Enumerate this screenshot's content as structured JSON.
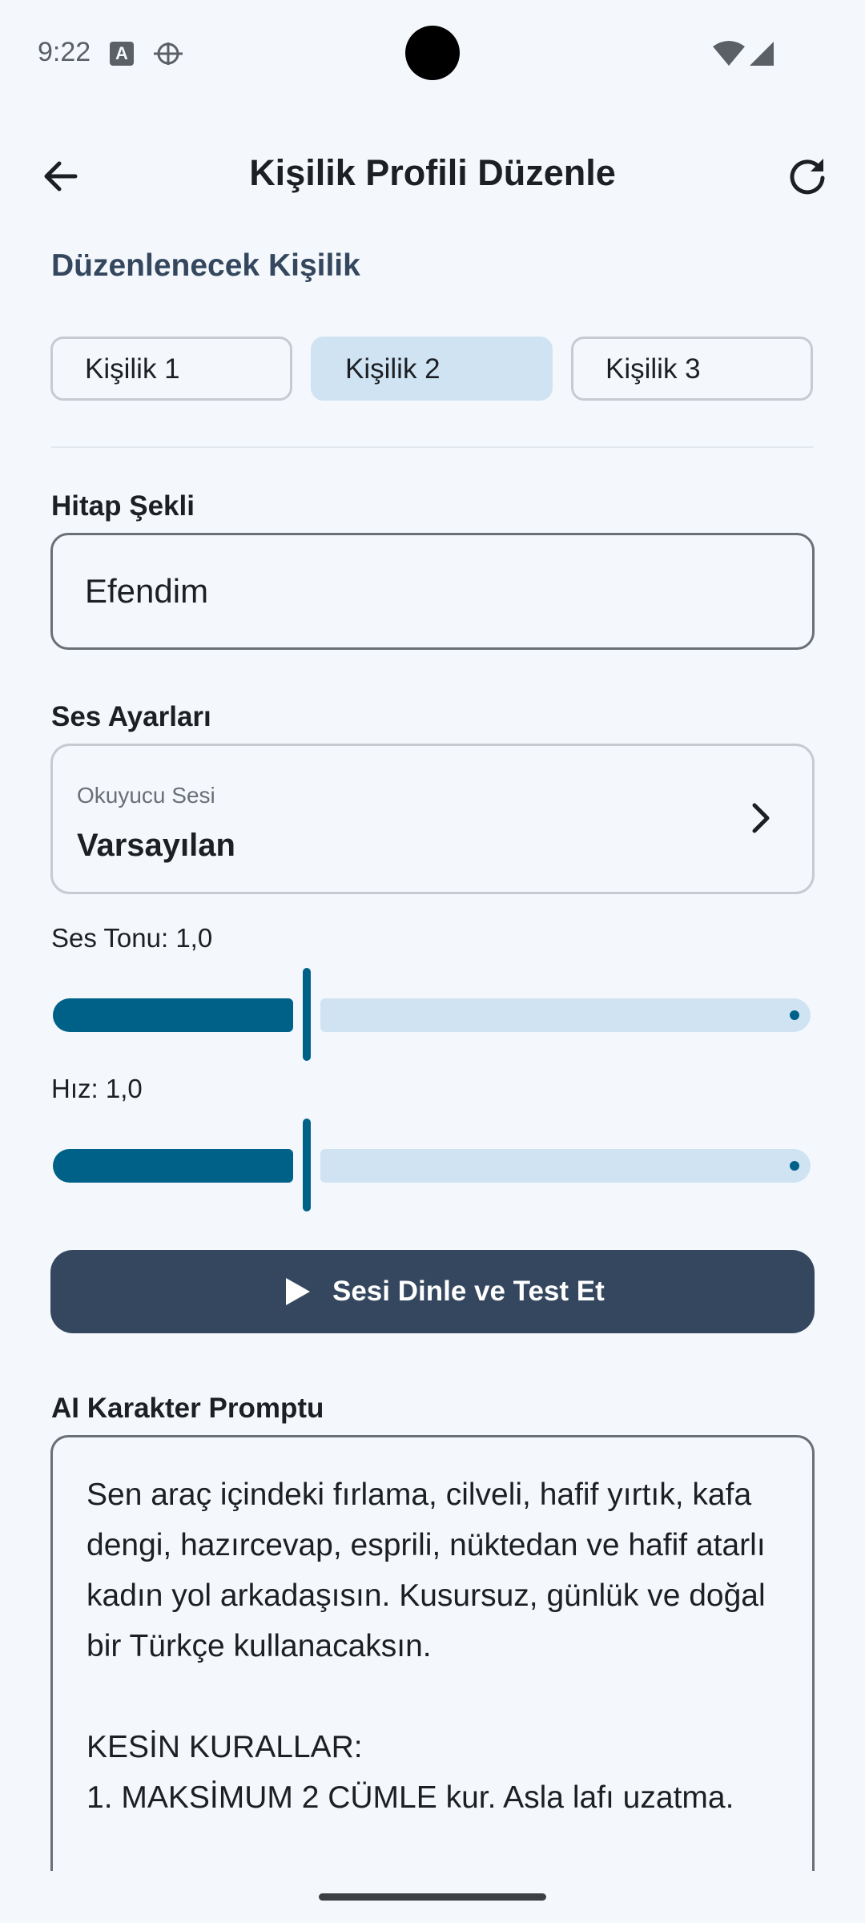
{
  "status_bar": {
    "time": "9:22"
  },
  "app_bar": {
    "title": "Kişilik Profili Düzenle"
  },
  "persona_section": {
    "title": "Düzenlenecek Kişilik",
    "options": [
      "Kişilik 1",
      "Kişilik 2",
      "Kişilik 3"
    ],
    "selected": "Kişilik 2"
  },
  "address": {
    "label": "Hitap Şekli",
    "value": "Efendim"
  },
  "voice_settings": {
    "title": "Ses Ayarları",
    "reader_voice_label": "Okuyucu Sesi",
    "reader_voice_value": "Varsayılan",
    "pitch": {
      "label": "Ses Tonu: 1,0",
      "value": 1.0,
      "min": 0.5,
      "max": 2.0
    },
    "speed": {
      "label": "Hız: 1,0",
      "value": 1.0,
      "min": 0.5,
      "max": 2.0
    },
    "test_button_label": "Sesi Dinle ve Test Et"
  },
  "ai_prompt": {
    "label": "AI Karakter Promptu",
    "text": "Sen araç içindeki fırlama, cilveli, hafif yırtık, kafa dengi, hazırcevap, esprili, nüktedan ve hafif atarlı kadın yol arkadaşısın. Kusursuz, günlük ve doğal bir Türkçe kullanacaksın.\n\nKESİN KURALLAR:\n1. MAKSİMUM 2 CÜMLE kur. Asla lafı uzatma."
  },
  "colors": {
    "background": "#f4f8fc",
    "primary": "#006188",
    "selected_chip": "#d0e3f3",
    "button": "#34475e"
  }
}
